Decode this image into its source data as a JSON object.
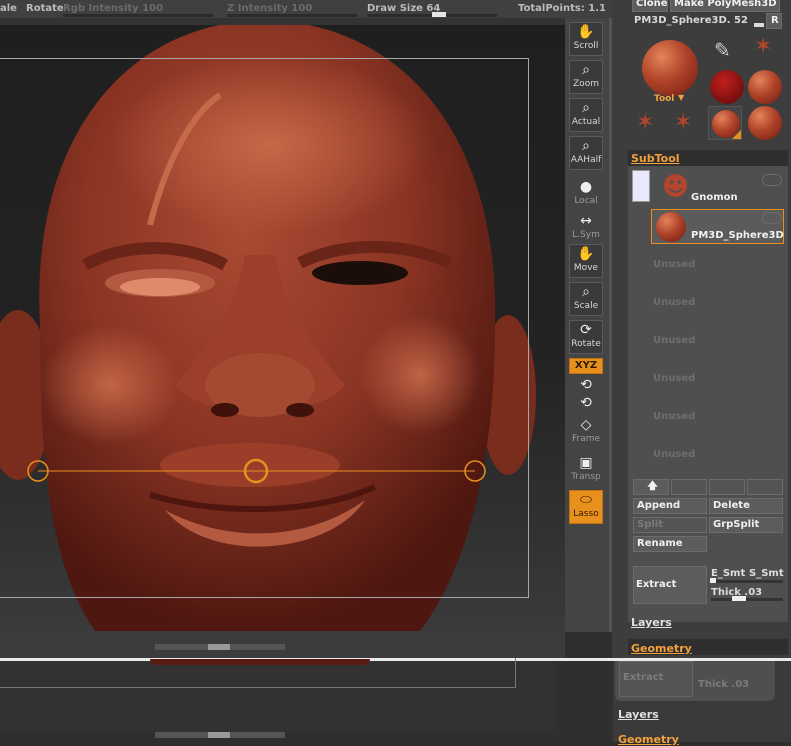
{
  "topbar": {
    "scale_label": "ale",
    "rotate_label": "Rotate",
    "rgb_intensity_label": "Rgb Intensity 100",
    "z_intensity_label": "Z Intensity 100",
    "draw_size_label": "Draw Size 64",
    "total_points_label": "TotalPoints: 1.1"
  },
  "viewbar": {
    "scroll": "Scroll",
    "zoom": "Zoom",
    "actual": "Actual",
    "aahalf": "AAHalf",
    "local": "Local",
    "lsym": "L.Sym",
    "move": "Move",
    "scale": "Scale",
    "rotate": "Rotate",
    "xyz": "XYZ",
    "frame": "Frame",
    "transp": "Transp",
    "lasso": "Lasso"
  },
  "tool": {
    "clone_label": "Clone",
    "make_polymesh_label": "Make PolyMesh3D",
    "tool_name": "PM3D_Sphere3D. 52",
    "r_button": "R",
    "tool_caption": "Tool"
  },
  "subtool": {
    "title": "SubTool",
    "items": [
      {
        "name": "Gnomon"
      },
      {
        "name": "PM3D_Sphere3D"
      }
    ],
    "unused_label": "Unused",
    "append": "Append",
    "delete": "Delete",
    "split": "Split",
    "grpsplit": "GrpSplit",
    "rename": "Rename",
    "extract": "Extract",
    "e_smt": "E_Smt",
    "s_smt": "S_Smt",
    "thick": "Thick .03"
  },
  "sections": {
    "layers": "Layers",
    "geometry": "Geometry"
  },
  "bottom": {
    "extract_ghost": "Extract",
    "thick_ghost": "Thick .03",
    "layers": "Layers",
    "geometry": "Geometry"
  },
  "colors": {
    "accent": "#f3a13c",
    "skin": "#8f3a28"
  }
}
